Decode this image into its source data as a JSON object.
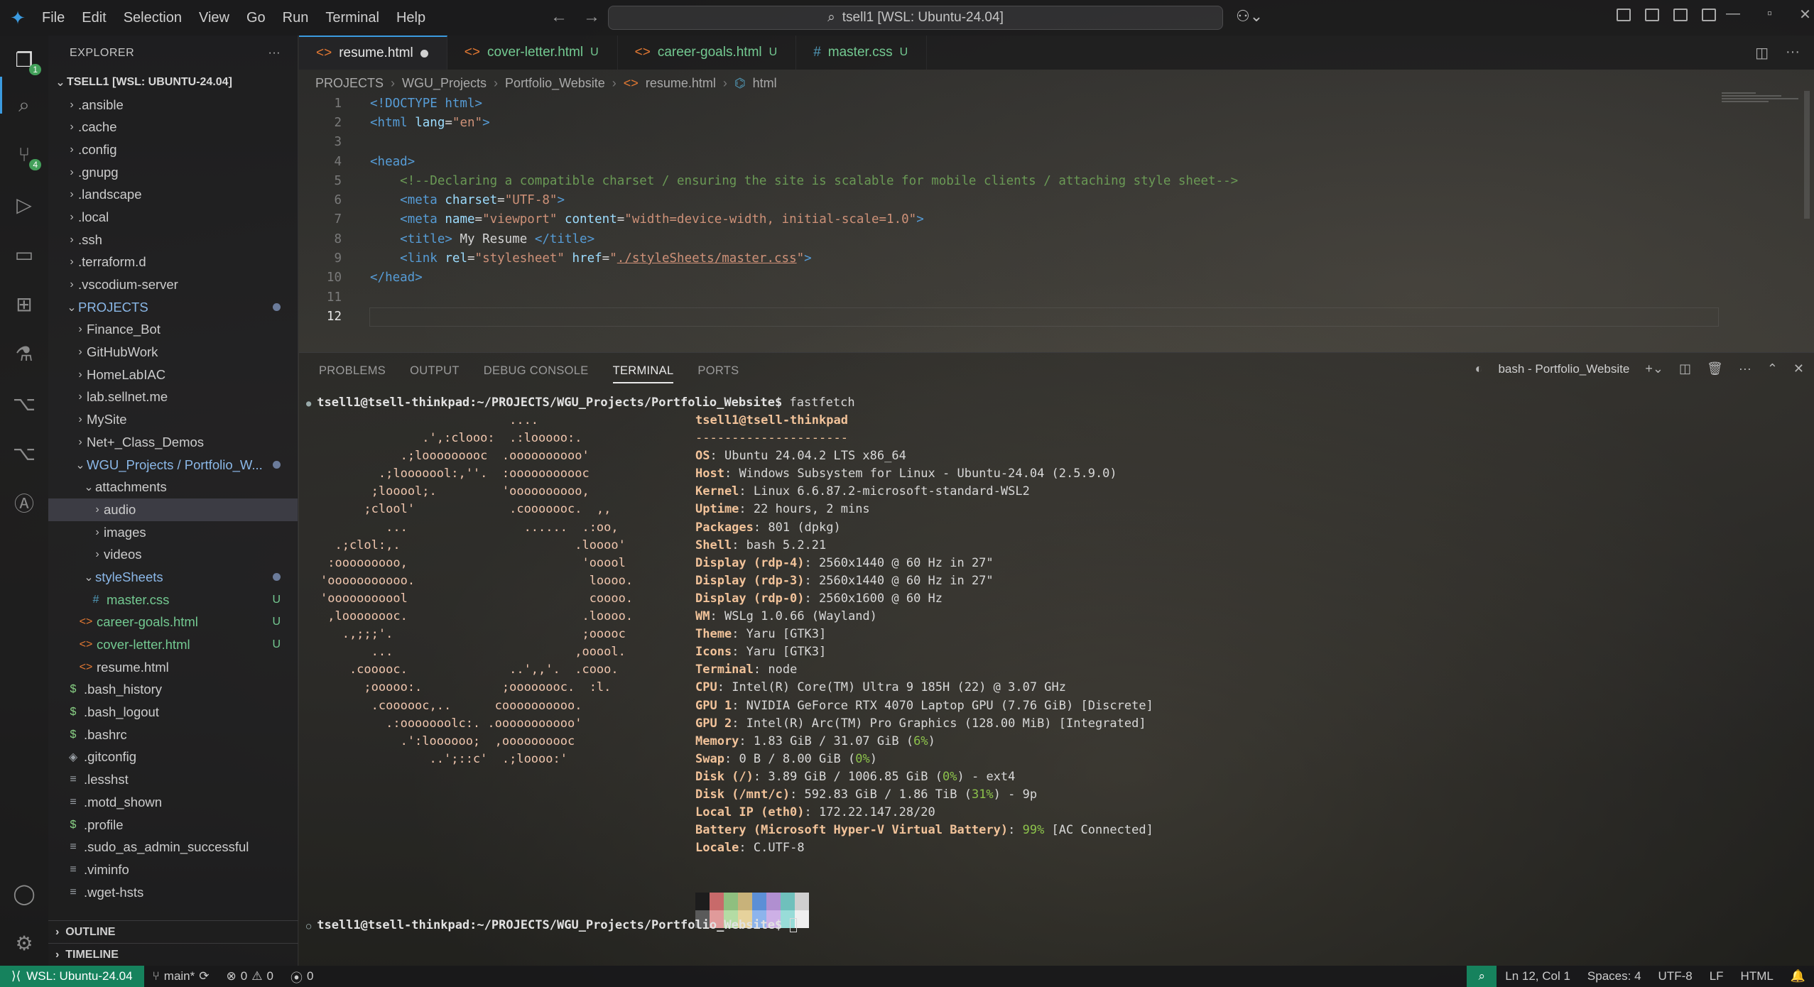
{
  "window": {
    "menu": [
      "File",
      "Edit",
      "Selection",
      "View",
      "Go",
      "Run",
      "Terminal",
      "Help"
    ],
    "command_center": "tsell1 [WSL: Ubuntu-24.04]"
  },
  "activity": {
    "source_control_badge": "4",
    "explorer_badge": "1"
  },
  "sidebar": {
    "title": "EXPLORER",
    "root": "TSELL1 [WSL: UBUNTU-24.04]",
    "items": [
      {
        "label": ".ansible"
      },
      {
        "label": ".cache"
      },
      {
        "label": ".config"
      },
      {
        "label": ".gnupg"
      },
      {
        "label": ".landscape"
      },
      {
        "label": ".local"
      },
      {
        "label": ".ssh"
      },
      {
        "label": ".terraform.d"
      },
      {
        "label": ".vscodium-server"
      },
      {
        "label": "PROJECTS"
      },
      {
        "label": "Finance_Bot"
      },
      {
        "label": "GitHubWork"
      },
      {
        "label": "HomeLabIAC"
      },
      {
        "label": "lab.sellnet.me"
      },
      {
        "label": "MySite"
      },
      {
        "label": "Net+_Class_Demos"
      },
      {
        "label": "WGU_Projects / Portfolio_W..."
      },
      {
        "label": "attachments"
      },
      {
        "label": "audio"
      },
      {
        "label": "images"
      },
      {
        "label": "videos"
      },
      {
        "label": "styleSheets"
      },
      {
        "label": "master.css",
        "status": "U"
      },
      {
        "label": "career-goals.html",
        "status": "U"
      },
      {
        "label": "cover-letter.html",
        "status": "U"
      },
      {
        "label": "resume.html"
      },
      {
        "label": ".bash_history"
      },
      {
        "label": ".bash_logout"
      },
      {
        "label": ".bashrc"
      },
      {
        "label": ".gitconfig"
      },
      {
        "label": ".lesshst"
      },
      {
        "label": ".motd_shown"
      },
      {
        "label": ".profile"
      },
      {
        "label": ".sudo_as_admin_successful"
      },
      {
        "label": ".viminfo"
      },
      {
        "label": ".wget-hsts"
      }
    ],
    "outline": "OUTLINE",
    "timeline": "TIMELINE"
  },
  "tabs": [
    {
      "label": "resume.html",
      "active": true
    },
    {
      "label": "cover-letter.html",
      "status": "U"
    },
    {
      "label": "career-goals.html",
      "status": "U"
    },
    {
      "label": "master.css",
      "status": "U"
    }
  ],
  "breadcrumbs": [
    "PROJECTS",
    "WGU_Projects",
    "Portfolio_Website",
    "resume.html",
    "html"
  ],
  "editor": {
    "line_numbers": [
      "1",
      "2",
      "3",
      "4",
      "5",
      "6",
      "7",
      "8",
      "9",
      "10",
      "11",
      "12"
    ],
    "l1": "<!DOCTYPE html>",
    "l2a": "<html ",
    "l2b": "lang",
    "l2c": "=",
    "l2d": "\"en\"",
    "l2e": ">",
    "l4": "<head>",
    "l5": "<!--Declaring a compatible charset / ensuring the site is scalable for mobile clients / attaching style sheet-->",
    "l6a": "<meta ",
    "l6b": "charset",
    "l6c": "=",
    "l6d": "\"UTF-8\"",
    "l6e": ">",
    "l7a": "<meta ",
    "l7b": "name",
    "l7c": "=",
    "l7d": "\"viewport\"",
    "l7e": " content",
    "l7f": "=",
    "l7g": "\"width=device-width, initial-scale=1.0\"",
    "l7h": ">",
    "l8a": "<title>",
    "l8b": " My Resume ",
    "l8c": "</title>",
    "l9a": "<link ",
    "l9b": "rel",
    "l9c": "=",
    "l9d": "\"stylesheet\"",
    "l9e": " href",
    "l9f": "=",
    "l9g": "\"",
    "l9h": "./styleSheets/master.css",
    "l9i": "\"",
    "l9j": ">",
    "l10": "</head>"
  },
  "panel": {
    "tabs": [
      "PROBLEMS",
      "OUTPUT",
      "DEBUG CONSOLE",
      "TERMINAL",
      "PORTS"
    ],
    "active_tab": "TERMINAL",
    "terminal_name": "bash - Portfolio_Website"
  },
  "terminal": {
    "prompt": "tsell1@tsell-thinkpad:~/PROJECTS/WGU_Projects/Portfolio_Website$",
    "command": " fastfetch",
    "ascii_art": [
      "                          ....",
      "              .',:clooo:  .:looooo:.",
      "           .;looooooooc  .oooooooooo'",
      "        .;looooool:,''.  :ooooooooooc",
      "       ;looool;.         'oooooooooo,",
      "      ;clool'             .cooooooc.  ,,",
      "         ...                ......  .:oo,",
      "  .;clol:,.                        .loooo'",
      " :ooooooooo,                        'ooool",
      "'ooooooooooo.                        loooo.",
      "'ooooooooool                         coooo.",
      " ,loooooooc.                        .loooo.",
      "   .,;;;'.                          ;ooooc",
      "       ...                         ,ooool.",
      "    .cooooc.              ..',,'.  .cooo.",
      "      ;ooooo:.           ;oooooooc.  :l.",
      "       .coooooc,..      coooooooooo.",
      "         .:ooooooolc:. .ooooooooooo'",
      "           .':loooooo;  ,oooooooooc",
      "               ..';::c'  .;loooo:'"
    ],
    "header": "tsell1@tsell-thinkpad",
    "separator": "---------------------",
    "info": [
      {
        "key": "OS",
        "value": "Ubuntu 24.04.2 LTS x86_64"
      },
      {
        "key": "Host",
        "value": "Windows Subsystem for Linux - Ubuntu-24.04 (2.5.9.0)"
      },
      {
        "key": "Kernel",
        "value": "Linux 6.6.87.2-microsoft-standard-WSL2"
      },
      {
        "key": "Uptime",
        "value": "22 hours, 2 mins"
      },
      {
        "key": "Packages",
        "value": "801 (dpkg)"
      },
      {
        "key": "Shell",
        "value": "bash 5.2.21"
      },
      {
        "key": "Display (rdp-4)",
        "value": "2560x1440 @ 60 Hz in 27\""
      },
      {
        "key": "Display (rdp-3)",
        "value": "2560x1440 @ 60 Hz in 27\""
      },
      {
        "key": "Display (rdp-0)",
        "value": "2560x1600 @ 60 Hz"
      },
      {
        "key": "WM",
        "value": "WSLg 1.0.66 (Wayland)"
      },
      {
        "key": "Theme",
        "value": "Yaru [GTK3]"
      },
      {
        "key": "Icons",
        "value": "Yaru [GTK3]"
      },
      {
        "key": "Terminal",
        "value": "node"
      },
      {
        "key": "CPU",
        "value": "Intel(R) Core(TM) Ultra 9 185H (22) @ 3.07 GHz"
      },
      {
        "key": "GPU 1",
        "value": "NVIDIA GeForce RTX 4070 Laptop GPU (7.76 GiB) [Discrete]"
      },
      {
        "key": "GPU 2",
        "value": "Intel(R) Arc(TM) Pro Graphics (128.00 MiB) [Integrated]"
      },
      {
        "key": "Memory",
        "value": "1.83 GiB / 31.07 GiB (",
        "highlight": "6%",
        "suffix": ")"
      },
      {
        "key": "Swap",
        "value": "0 B / 8.00 GiB (",
        "highlight": "0%",
        "suffix": ")"
      },
      {
        "key": "Disk (/)",
        "value": "3.89 GiB / 1006.85 GiB (",
        "highlight": "0%",
        "suffix": ") - ext4"
      },
      {
        "key": "Disk (/mnt/c)",
        "value": "592.83 GiB / 1.86 TiB (",
        "highlight": "31%",
        "suffix": ") - 9p"
      },
      {
        "key": "Local IP (eth0)",
        "value": "172.22.147.28/20"
      },
      {
        "key": "Battery (Microsoft Hyper-V Virtual Battery)",
        "value": "",
        "highlight": "99%",
        "suffix": " [AC Connected]"
      },
      {
        "key": "Locale",
        "value": "C.UTF-8"
      }
    ],
    "palette_top": [
      "#1d1d1d",
      "#c86a6a",
      "#8fbf7f",
      "#c8b27a",
      "#5c8fd6",
      "#b08fd0",
      "#6fc0bc",
      "#cfcfcf"
    ],
    "palette_bottom": [
      "#5a5a5a",
      "#e09a9a",
      "#b4dca4",
      "#e6d29c",
      "#8db4ec",
      "#cdb0e6",
      "#98dcd8",
      "#efefef"
    ],
    "final_prompt": "tsell1@tsell-thinkpad:~/PROJECTS/WGU_Projects/Portfolio_Website$"
  },
  "statusbar": {
    "remote": "WSL: Ubuntu-24.04",
    "branch": "main*",
    "errors": "0",
    "warnings": "0",
    "ports": "0",
    "position": "Ln 12, Col 1",
    "spaces": "Spaces: 4",
    "encoding": "UTF-8",
    "eol": "LF",
    "language": "HTML"
  }
}
